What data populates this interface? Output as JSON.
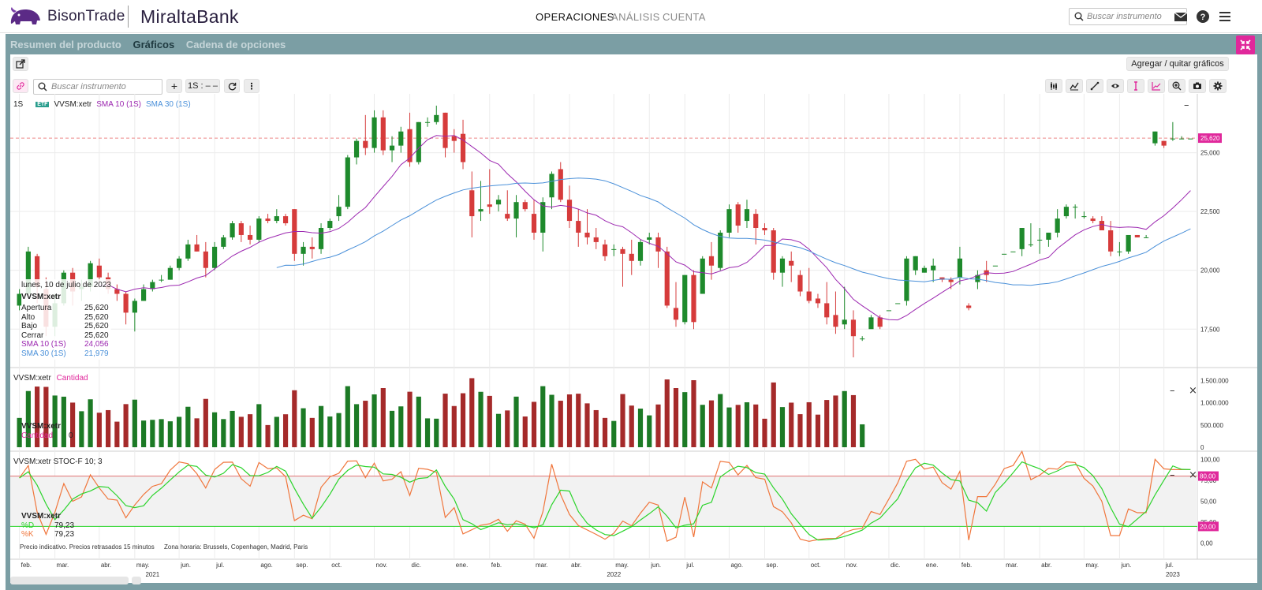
{
  "header": {
    "brand1": "BisonTrade",
    "brand2": "MiraltaBank",
    "nav": [
      "OPERACIONES",
      "ANÁLISIS",
      "CUENTA"
    ],
    "search_placeholder": "Buscar instrumento"
  },
  "panel": {
    "tabs": [
      "Resumen del producto",
      "Gráficos",
      "Cadena de opciones"
    ],
    "active_tab": "Gráficos",
    "add_remove_label": "Agregar / quitar gráficos"
  },
  "toolbar": {
    "search_placeholder": "Buscar instrumento",
    "plus_label": "+",
    "interval_label": "1S : – –",
    "more_label": "⋮"
  },
  "price_pane": {
    "period": "1S",
    "etf_badge": "ETF",
    "symbol": "VVSM:xetr",
    "sma10_label": "SMA 10 (1S)",
    "sma30_label": "SMA 30 (1S)",
    "last_price": "25,620",
    "y_ticks": [
      "25,000",
      "22,500",
      "20,000",
      "17,500"
    ]
  },
  "info_box": {
    "date": "lunes, 10 de julio de 2023",
    "symbol": "VVSM:xetr",
    "rows": [
      {
        "k": "Apertura",
        "v": "25,620"
      },
      {
        "k": "Alto",
        "v": "25,620"
      },
      {
        "k": "Bajo",
        "v": "25,620"
      },
      {
        "k": "Cerrar",
        "v": "25,620"
      },
      {
        "k": "SMA 10 (1S)",
        "v": "24,056"
      },
      {
        "k": "SMA 30 (1S)",
        "v": "21,979"
      }
    ]
  },
  "volume_pane": {
    "title_symbol": "VVSM:xetr",
    "title_series": "Cantidad",
    "info_symbol": "VVSM:xetr",
    "info_series": "Cantidad",
    "info_value": "0",
    "y_ticks": [
      "1.500.000",
      "1.000.000",
      "500.000",
      "0"
    ]
  },
  "stoch_pane": {
    "title": "VVSM:xetr  STOC-F 10; 3",
    "info_symbol": "VVSM:xetr",
    "d_label": "%D",
    "d_value": "79,23",
    "k_label": "%K",
    "k_value": "79,23",
    "upper_level": "80,00",
    "lower_level": "20,00",
    "y_ticks": [
      "100,00",
      "75,00",
      "50,00",
      "25,00",
      "0,00"
    ],
    "footer_note": "Precio indicativo. Precios retrasados 15 minutos",
    "footer_tz": "Zona horaria: Brussels, Copenhagen, Madrid, Paris"
  },
  "x_axis": {
    "months": [
      "feb.",
      "mar.",
      "abr.",
      "may.",
      "jun.",
      "jul.",
      "ago.",
      "sep.",
      "oct.",
      "nov.",
      "dic.",
      "ene.",
      "feb.",
      "mar.",
      "abr.",
      "may.",
      "jun.",
      "jul.",
      "ago.",
      "sep.",
      "oct.",
      "nov.",
      "dic.",
      "ene.",
      "feb.",
      "mar.",
      "abr.",
      "may.",
      "jun.",
      "jul."
    ],
    "years": [
      "2021",
      "2022",
      "2023"
    ]
  },
  "colors": {
    "up": "#1e8a2c",
    "down": "#d63b3b",
    "volume_up": "#1c7a25",
    "volume_down": "#a52a2a",
    "sma10": "#9c27b0",
    "sma30": "#4a90d9",
    "stoch_d": "#2bd42b",
    "stoch_k": "#f0763c",
    "level_line": "#e07070",
    "accent": "#e0289b",
    "panel_bg": "#7b9ea4"
  },
  "chart_data": {
    "type": "candlestick",
    "series": [
      {
        "name": "VVSM:xetr",
        "ohlc": [
          [
            18.5,
            19.2,
            18.3,
            19.0
          ],
          [
            19.0,
            21.0,
            18.9,
            20.8
          ],
          [
            20.6,
            20.7,
            18.6,
            19.3
          ],
          [
            19.2,
            19.7,
            17.2,
            17.6
          ],
          [
            17.6,
            19.0,
            17.2,
            18.6
          ],
          [
            18.6,
            20.0,
            18.5,
            19.9
          ],
          [
            19.9,
            20.1,
            18.5,
            19.1
          ],
          [
            19.2,
            19.6,
            18.7,
            19.3
          ],
          [
            19.3,
            20.4,
            19.1,
            20.3
          ],
          [
            20.2,
            20.5,
            19.5,
            19.7
          ],
          [
            19.7,
            19.9,
            19.0,
            19.2
          ],
          [
            19.2,
            19.4,
            18.7,
            19.0
          ],
          [
            19.0,
            19.1,
            17.7,
            18.2
          ],
          [
            18.2,
            18.8,
            17.4,
            18.7
          ],
          [
            18.7,
            19.4,
            18.7,
            19.2
          ],
          [
            19.2,
            19.6,
            19.1,
            19.5
          ],
          [
            19.6,
            19.8,
            19.5,
            19.6
          ],
          [
            19.6,
            20.2,
            19.6,
            20.1
          ],
          [
            20.1,
            20.6,
            20.0,
            20.5
          ],
          [
            20.5,
            21.3,
            20.4,
            21.1
          ],
          [
            21.1,
            21.5,
            20.8,
            20.8
          ],
          [
            20.8,
            21.2,
            19.7,
            20.1
          ],
          [
            20.1,
            21.2,
            20.0,
            21.0
          ],
          [
            21.0,
            21.5,
            20.9,
            21.4
          ],
          [
            21.4,
            22.1,
            21.3,
            22.0
          ],
          [
            22.0,
            22.1,
            21.2,
            21.5
          ],
          [
            21.5,
            21.9,
            21.1,
            21.3
          ],
          [
            21.3,
            22.3,
            21.2,
            22.2
          ],
          [
            22.2,
            22.4,
            22.0,
            22.1
          ],
          [
            22.1,
            22.6,
            22.0,
            22.3
          ],
          [
            22.3,
            22.4,
            21.9,
            22.0
          ],
          [
            22.6,
            22.6,
            20.4,
            20.7
          ],
          [
            20.7,
            21.2,
            20.2,
            21.0
          ],
          [
            21.0,
            21.4,
            20.5,
            20.9
          ],
          [
            20.9,
            22.0,
            20.7,
            21.8
          ],
          [
            21.8,
            22.2,
            21.7,
            22.1
          ],
          [
            22.3,
            23.2,
            22.1,
            22.7
          ],
          [
            22.7,
            24.9,
            22.6,
            24.8
          ],
          [
            24.8,
            25.6,
            24.5,
            25.5
          ],
          [
            25.5,
            26.6,
            24.9,
            25.2
          ],
          [
            25.2,
            26.8,
            25.0,
            26.5
          ],
          [
            26.5,
            26.8,
            24.9,
            25.1
          ],
          [
            25.1,
            25.7,
            24.6,
            25.3
          ],
          [
            25.3,
            26.1,
            25.0,
            25.9
          ],
          [
            26.0,
            26.7,
            24.4,
            24.6
          ],
          [
            24.6,
            26.3,
            24.5,
            26.3
          ],
          [
            26.3,
            26.5,
            26.1,
            26.3
          ],
          [
            26.3,
            27.0,
            26.2,
            26.6
          ],
          [
            26.7,
            26.7,
            24.8,
            25.2
          ],
          [
            25.7,
            26.0,
            25.0,
            25.5
          ],
          [
            25.8,
            26.4,
            24.3,
            24.6
          ],
          [
            23.4,
            24.2,
            21.4,
            22.3
          ],
          [
            22.5,
            23.8,
            22.1,
            22.6
          ],
          [
            22.8,
            24.3,
            22.4,
            22.7
          ],
          [
            22.8,
            23.2,
            22.5,
            23.0
          ],
          [
            22.4,
            23.4,
            22.1,
            22.2
          ],
          [
            22.2,
            23.2,
            21.4,
            22.9
          ],
          [
            22.9,
            23.0,
            22.5,
            22.6
          ],
          [
            22.4,
            23.0,
            21.3,
            21.6
          ],
          [
            21.6,
            23.1,
            20.8,
            22.9
          ],
          [
            23.1,
            24.2,
            22.6,
            24.1
          ],
          [
            24.3,
            24.6,
            22.9,
            23.0
          ],
          [
            23.0,
            23.6,
            21.8,
            22.1
          ],
          [
            22.1,
            22.6,
            21.0,
            21.6
          ],
          [
            21.6,
            22.6,
            21.1,
            21.4
          ],
          [
            21.4,
            21.8,
            20.9,
            21.2
          ],
          [
            21.1,
            21.3,
            20.4,
            20.6
          ],
          [
            20.9,
            21.1,
            20.6,
            20.9
          ],
          [
            20.9,
            21.0,
            19.3,
            20.7
          ],
          [
            20.7,
            21.3,
            19.8,
            20.4
          ],
          [
            20.4,
            21.3,
            20.2,
            21.2
          ],
          [
            21.3,
            21.6,
            21.1,
            21.4
          ],
          [
            21.4,
            21.6,
            20.1,
            20.8
          ],
          [
            20.8,
            21.0,
            18.4,
            18.5
          ],
          [
            18.4,
            19.5,
            17.6,
            17.9
          ],
          [
            17.8,
            19.8,
            17.7,
            19.8
          ],
          [
            19.8,
            20.0,
            17.5,
            17.8
          ],
          [
            19.0,
            20.6,
            19.0,
            20.5
          ],
          [
            20.6,
            21.2,
            19.6,
            20.2
          ],
          [
            20.1,
            21.7,
            20.0,
            21.6
          ],
          [
            21.6,
            22.8,
            21.4,
            22.6
          ],
          [
            22.8,
            22.9,
            21.6,
            21.9
          ],
          [
            22.1,
            23.0,
            21.8,
            22.6
          ],
          [
            22.4,
            22.6,
            21.1,
            21.8
          ],
          [
            21.8,
            22.0,
            21.5,
            21.7
          ],
          [
            21.7,
            21.8,
            19.6,
            19.9
          ],
          [
            19.9,
            20.6,
            19.3,
            20.5
          ],
          [
            20.4,
            20.8,
            19.5,
            20.2
          ],
          [
            19.8,
            20.0,
            18.9,
            19.1
          ],
          [
            19.1,
            20.1,
            18.6,
            18.7
          ],
          [
            18.8,
            19.0,
            18.4,
            18.6
          ],
          [
            18.6,
            19.5,
            17.7,
            18.0
          ],
          [
            18.1,
            19.1,
            17.3,
            17.6
          ],
          [
            17.7,
            19.3,
            17.5,
            17.9
          ],
          [
            17.9,
            18.3,
            16.3,
            17.2
          ],
          [
            17.1,
            17.2,
            17.0,
            17.1
          ],
          [
            17.5,
            18.1,
            17.6,
            18.0
          ],
          [
            18.0,
            18.1,
            17.5,
            17.6
          ],
          [
            18.3,
            18.3,
            18.3,
            18.3
          ],
          [
            18.6,
            18.6,
            18.6,
            18.6
          ],
          [
            18.7,
            20.6,
            18.5,
            20.5
          ],
          [
            20.0,
            20.6,
            19.8,
            20.6
          ],
          [
            19.9,
            20.2,
            19.9,
            20.1
          ],
          [
            20.0,
            20.5,
            19.5,
            20.2
          ],
          [
            19.7,
            19.7,
            19.5,
            19.6
          ],
          [
            19.6,
            19.7,
            19.2,
            19.5
          ],
          [
            19.7,
            21.0,
            19.4,
            20.5
          ],
          [
            18.5,
            18.6,
            18.3,
            18.4
          ],
          [
            19.5,
            20.0,
            19.2,
            19.8
          ],
          [
            20.0,
            20.4,
            19.5,
            19.8
          ],
          [
            20.2,
            20.2,
            20.2,
            20.2
          ],
          [
            20.7,
            20.7,
            20.7,
            20.7
          ],
          [
            20.8,
            20.8,
            20.8,
            20.8
          ],
          [
            20.9,
            21.5,
            20.6,
            21.8
          ],
          [
            21.1,
            22.0,
            21.0,
            21.1
          ],
          [
            21.3,
            21.8,
            20.7,
            21.3
          ],
          [
            21.3,
            21.6,
            21.0,
            21.6
          ],
          [
            21.6,
            22.6,
            21.4,
            22.2
          ],
          [
            22.3,
            22.8,
            22.2,
            22.7
          ],
          [
            22.7,
            22.8,
            22.2,
            22.7
          ],
          [
            22.3,
            22.5,
            22.2,
            22.3
          ],
          [
            22.2,
            22.3,
            22.0,
            22.1
          ],
          [
            22.1,
            22.3,
            21.8,
            21.7
          ],
          [
            21.7,
            22.1,
            20.6,
            20.8
          ],
          [
            20.8,
            21.2,
            20.6,
            20.8
          ],
          [
            20.8,
            21.4,
            20.7,
            21.5
          ],
          [
            21.5,
            21.5,
            21.4,
            21.4
          ],
          [
            21.4,
            21.5,
            21.4,
            21.4
          ],
          [
            25.4,
            25.9,
            25.3,
            25.9
          ],
          [
            25.5,
            25.5,
            25.2,
            25.3
          ],
          [
            25.6,
            26.3,
            25.5,
            25.6
          ],
          [
            25.6,
            25.7,
            25.6,
            25.6
          ],
          [
            25.6,
            25.6,
            25.6,
            25.6
          ]
        ]
      },
      {
        "name": "SMA 10 (1S)"
      },
      {
        "name": "SMA 30 (1S)"
      }
    ],
    "ylim": [
      16,
      27.5
    ],
    "volume_ylim": [
      0,
      1700000
    ],
    "stoch_ylim": [
      -5,
      105
    ]
  }
}
